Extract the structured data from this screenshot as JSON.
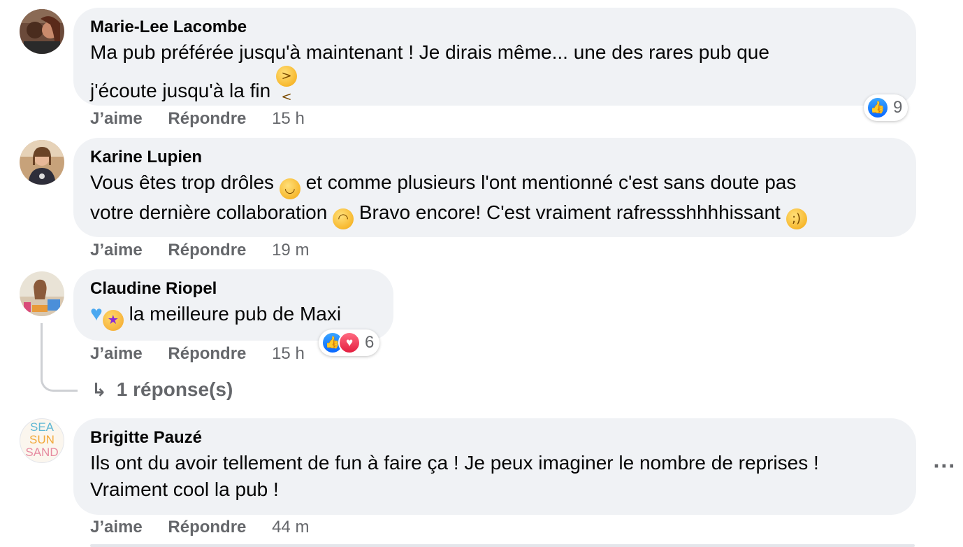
{
  "actions": {
    "like": "J’aime",
    "reply": "Répondre"
  },
  "comments": [
    {
      "author": "Marie-Lee Lacombe",
      "line1": "Ma pub préférée jusqu'à maintenant ! Je dirais même... une des rares pub que",
      "line2": "j'écoute jusqu'à la fin",
      "time": "15 h",
      "reaction_count": "9",
      "reactions": [
        "like-icon"
      ]
    },
    {
      "author": "Karine Lupien",
      "line1a": "Vous êtes trop drôles",
      "line1b": "et comme plusieurs l'ont mentionné c'est sans doute pas",
      "line2a": "votre dernière collaboration",
      "line2b": "Bravo encore! C'est vraiment rafressshhhhissant",
      "time": "19 m"
    },
    {
      "author": "Claudine Riopel",
      "text": "la meilleure pub de Maxi",
      "time": "15 h",
      "reaction_count": "6",
      "reactions": [
        "like-icon",
        "love-icon"
      ],
      "replies_label": "1 réponse(s)"
    },
    {
      "author": "Brigitte Pauzé",
      "line1": "Ils ont du avoir tellement de fun à faire ça ! Je peux imaginer le nombre de reprises !",
      "line2": "Vraiment cool la pub !",
      "time": "44 m",
      "avatar_text": [
        "SEA",
        "SUN",
        "SAND"
      ]
    }
  ],
  "colors": {
    "bubble": "#f0f2f5",
    "meta": "#65676b",
    "like": "#0866ff",
    "love": "#e41e3f"
  }
}
